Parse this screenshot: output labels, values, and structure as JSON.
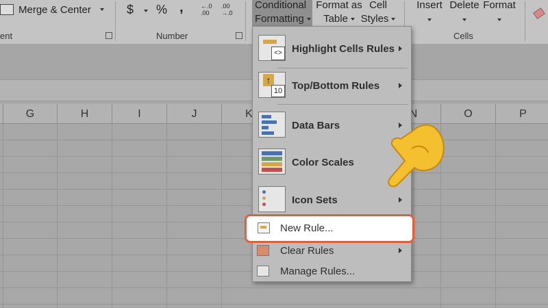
{
  "ribbon": {
    "merge_center": "Merge & Center",
    "alignment_tail": "ent",
    "number_group": "Number",
    "currency": "$",
    "percent": "%",
    "comma": ",",
    "inc_decimal_top": "←.0",
    "inc_decimal_bottom": ".00",
    "dec_decimal_top": ".00",
    "dec_decimal_bottom": "→.0",
    "cf_line1": "Conditional",
    "cf_line2": "Formatting",
    "fat_line1": "Format as",
    "fat_line2": "Table",
    "cs_line1": "Cell",
    "cs_line2": "Styles",
    "insert": "Insert",
    "delete": "Delete",
    "format": "Format",
    "cells_group": "Cells"
  },
  "columns": [
    "G",
    "H",
    "I",
    "J",
    "K",
    "N",
    "O",
    "P"
  ],
  "menu": {
    "highlight": "Highlight Cells Rules",
    "topbottom": "Top/Bottom Rules",
    "topbottom_icon_text": "10",
    "highlight_icon_text": "<>",
    "databars": "Data Bars",
    "colorscales": "Color Scales",
    "iconsets": "Icon Sets",
    "newrule": "New Rule...",
    "clearrules": "Clear Rules",
    "managerules": "Manage Rules..."
  },
  "colors": {
    "highlight_border": "#e0603a",
    "hand": "#f5c030"
  }
}
